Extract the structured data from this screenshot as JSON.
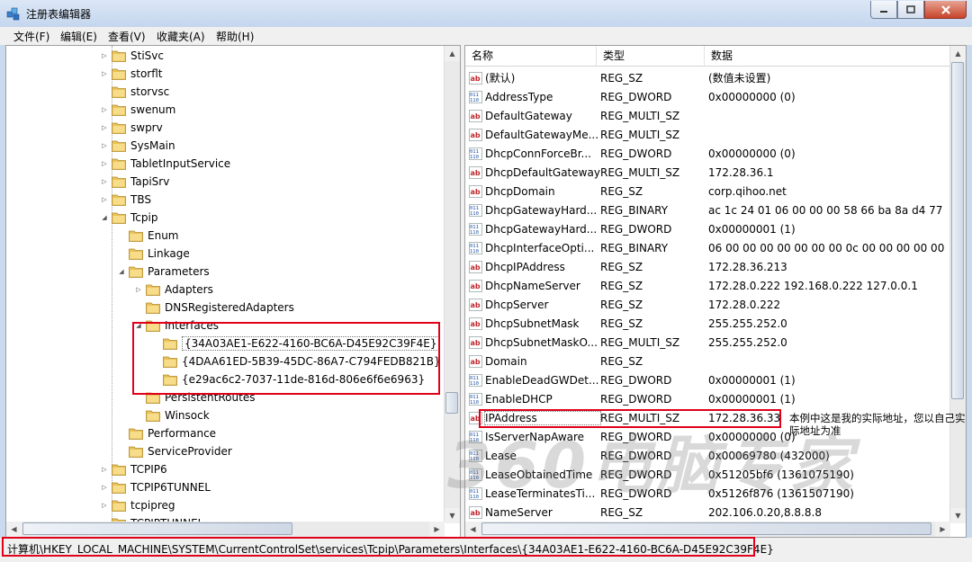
{
  "window": {
    "title": "注册表编辑器"
  },
  "menu": [
    "文件(F)",
    "编辑(E)",
    "查看(V)",
    "收藏夹(A)",
    "帮助(H)"
  ],
  "tree": [
    {
      "label": "StiSvc",
      "level": 0,
      "exp": "closed"
    },
    {
      "label": "storflt",
      "level": 0,
      "exp": "closed"
    },
    {
      "label": "storvsc",
      "level": 0,
      "exp": "none"
    },
    {
      "label": "swenum",
      "level": 0,
      "exp": "closed"
    },
    {
      "label": "swprv",
      "level": 0,
      "exp": "closed"
    },
    {
      "label": "SysMain",
      "level": 0,
      "exp": "closed"
    },
    {
      "label": "TabletInputService",
      "level": 0,
      "exp": "closed"
    },
    {
      "label": "TapiSrv",
      "level": 0,
      "exp": "closed"
    },
    {
      "label": "TBS",
      "level": 0,
      "exp": "closed"
    },
    {
      "label": "Tcpip",
      "level": 0,
      "exp": "open"
    },
    {
      "label": "Enum",
      "level": 1,
      "exp": "none"
    },
    {
      "label": "Linkage",
      "level": 1,
      "exp": "none"
    },
    {
      "label": "Parameters",
      "level": 1,
      "exp": "open"
    },
    {
      "label": "Adapters",
      "level": 2,
      "exp": "closed"
    },
    {
      "label": "DNSRegisteredAdapters",
      "level": 2,
      "exp": "none"
    },
    {
      "label": "Interfaces",
      "level": 2,
      "exp": "open"
    },
    {
      "label": "{34A03AE1-E622-4160-BC6A-D45E92C39F4E}",
      "level": 3,
      "exp": "none",
      "selected": true
    },
    {
      "label": "{4DAA61ED-5B39-45DC-86A7-C794FEDB821B}",
      "level": 3,
      "exp": "none"
    },
    {
      "label": "{e29ac6c2-7037-11de-816d-806e6f6e6963}",
      "level": 3,
      "exp": "none"
    },
    {
      "label": "PersistentRoutes",
      "level": 2,
      "exp": "none"
    },
    {
      "label": "Winsock",
      "level": 2,
      "exp": "none"
    },
    {
      "label": "Performance",
      "level": 1,
      "exp": "none"
    },
    {
      "label": "ServiceProvider",
      "level": 1,
      "exp": "none"
    },
    {
      "label": "TCPIP6",
      "level": 0,
      "exp": "closed"
    },
    {
      "label": "TCPIP6TUNNEL",
      "level": 0,
      "exp": "closed"
    },
    {
      "label": "tcpipreg",
      "level": 0,
      "exp": "closed"
    },
    {
      "label": "TCPIPTUNNEL",
      "level": 0,
      "exp": "none"
    }
  ],
  "columns": {
    "name": "名称",
    "type": "类型",
    "data": "数据"
  },
  "values": [
    {
      "icon": "string",
      "name": "(默认)",
      "type": "REG_SZ",
      "data": "(数值未设置)"
    },
    {
      "icon": "binary",
      "name": "AddressType",
      "type": "REG_DWORD",
      "data": "0x00000000 (0)"
    },
    {
      "icon": "string",
      "name": "DefaultGateway",
      "type": "REG_MULTI_SZ",
      "data": ""
    },
    {
      "icon": "string",
      "name": "DefaultGatewayMe...",
      "type": "REG_MULTI_SZ",
      "data": ""
    },
    {
      "icon": "binary",
      "name": "DhcpConnForceBr...",
      "type": "REG_DWORD",
      "data": "0x00000000 (0)"
    },
    {
      "icon": "string",
      "name": "DhcpDefaultGateway",
      "type": "REG_MULTI_SZ",
      "data": "172.28.36.1"
    },
    {
      "icon": "string",
      "name": "DhcpDomain",
      "type": "REG_SZ",
      "data": "corp.qihoo.net"
    },
    {
      "icon": "binary",
      "name": "DhcpGatewayHard...",
      "type": "REG_BINARY",
      "data": "ac 1c 24 01 06 00 00 00 58 66 ba 8a d4 77"
    },
    {
      "icon": "binary",
      "name": "DhcpGatewayHard...",
      "type": "REG_DWORD",
      "data": "0x00000001 (1)"
    },
    {
      "icon": "binary",
      "name": "DhcpInterfaceOpti...",
      "type": "REG_BINARY",
      "data": "06 00 00 00 00 00 00 00 0c 00 00 00 00 00 00"
    },
    {
      "icon": "string",
      "name": "DhcpIPAddress",
      "type": "REG_SZ",
      "data": "172.28.36.213"
    },
    {
      "icon": "string",
      "name": "DhcpNameServer",
      "type": "REG_SZ",
      "data": "172.28.0.222 192.168.0.222 127.0.0.1"
    },
    {
      "icon": "string",
      "name": "DhcpServer",
      "type": "REG_SZ",
      "data": "172.28.0.222"
    },
    {
      "icon": "string",
      "name": "DhcpSubnetMask",
      "type": "REG_SZ",
      "data": "255.255.252.0"
    },
    {
      "icon": "string",
      "name": "DhcpSubnetMaskO...",
      "type": "REG_MULTI_SZ",
      "data": "255.255.252.0"
    },
    {
      "icon": "string",
      "name": "Domain",
      "type": "REG_SZ",
      "data": ""
    },
    {
      "icon": "binary",
      "name": "EnableDeadGWDet...",
      "type": "REG_DWORD",
      "data": "0x00000001 (1)"
    },
    {
      "icon": "binary",
      "name": "EnableDHCP",
      "type": "REG_DWORD",
      "data": "0x00000001 (1)"
    },
    {
      "icon": "string",
      "name": "IPAddress",
      "type": "REG_MULTI_SZ",
      "data": "172.28.36.33",
      "highlight": true
    },
    {
      "icon": "binary",
      "name": "IsServerNapAware",
      "type": "REG_DWORD",
      "data": "0x00000000 (0)"
    },
    {
      "icon": "binary",
      "name": "Lease",
      "type": "REG_DWORD",
      "data": "0x00069780 (432000)"
    },
    {
      "icon": "binary",
      "name": "LeaseObtainedTime",
      "type": "REG_DWORD",
      "data": "0x51205bf6 (1361075190)"
    },
    {
      "icon": "binary",
      "name": "LeaseTerminatesTi...",
      "type": "REG_DWORD",
      "data": "0x5126f876 (1361507190)"
    },
    {
      "icon": "string",
      "name": "NameServer",
      "type": "REG_SZ",
      "data": "202.106.0.20,8.8.8.8"
    }
  ],
  "annotation": "本例中这是我的实际地址，您以自己实际地址为准",
  "watermark": "360电脑专家",
  "status": {
    "path": "计算机\\HKEY_LOCAL_MACHINE\\SYSTEM\\CurrentControlSet\\services\\Tcpip\\Parameters\\Interfaces\\{34A03AE1-E622-4160-BC6A-D45E92C39F4E}"
  },
  "colors": {
    "highlight_box": "#e0001a",
    "folder": "#e9c25a"
  }
}
